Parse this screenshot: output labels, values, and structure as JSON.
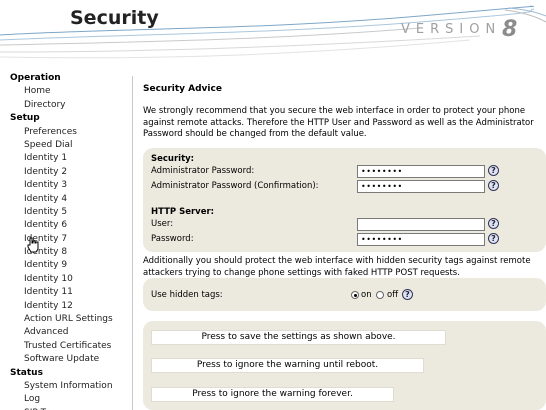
{
  "header": {
    "title": "Security",
    "version_word": "VERSION",
    "version_number": "8"
  },
  "sidebar": {
    "sections": [
      {
        "label": "Operation",
        "items": [
          "Home",
          "Directory"
        ]
      },
      {
        "label": "Setup",
        "items": [
          "Preferences",
          "Speed Dial",
          "Identity 1",
          "Identity 2",
          "Identity 3",
          "Identity 4",
          "Identity 5",
          "Identity 6",
          "Identity 7",
          "Identity 8",
          "Identity 9",
          "Identity 10",
          "Identity 11",
          "Identity 12",
          "Action URL Settings",
          "Advanced",
          "Trusted Certificates",
          "Software Update"
        ]
      },
      {
        "label": "Status",
        "items": [
          "System Information",
          "Log",
          "SIP Trace"
        ]
      }
    ]
  },
  "main": {
    "heading": "Security Advice",
    "advice": "We strongly recommend that you secure the web interface in order to protect your phone against remote attacks. Therefore the HTTP User and Password as well as the Administrator Password should be changed from the default value.",
    "security_label": "Security:",
    "admin_pw_label": "Administrator Password:",
    "admin_pw_value": "••••••••",
    "admin_pw_confirm_label": "Administrator Password (Confirmation):",
    "admin_pw_confirm_value": "••••••••",
    "http_label": "HTTP Server:",
    "user_label": "User:",
    "user_value": "",
    "password_label": "Password:",
    "password_value": "••••••••",
    "help_glyph": "?",
    "note": "Additionally you should protect the web interface with hidden security tags against remote attackers trying to change phone settings with faked HTTP POST requests.",
    "hidden_tags_label": "Use hidden tags:",
    "on_label": "on",
    "off_label": "off",
    "hidden_tags_selected": "on",
    "save_button": "Press to save the settings as shown above.",
    "ignore_reboot_button": "Press to ignore the warning until reboot.",
    "ignore_forever_button": "Press to ignore the warning forever."
  }
}
